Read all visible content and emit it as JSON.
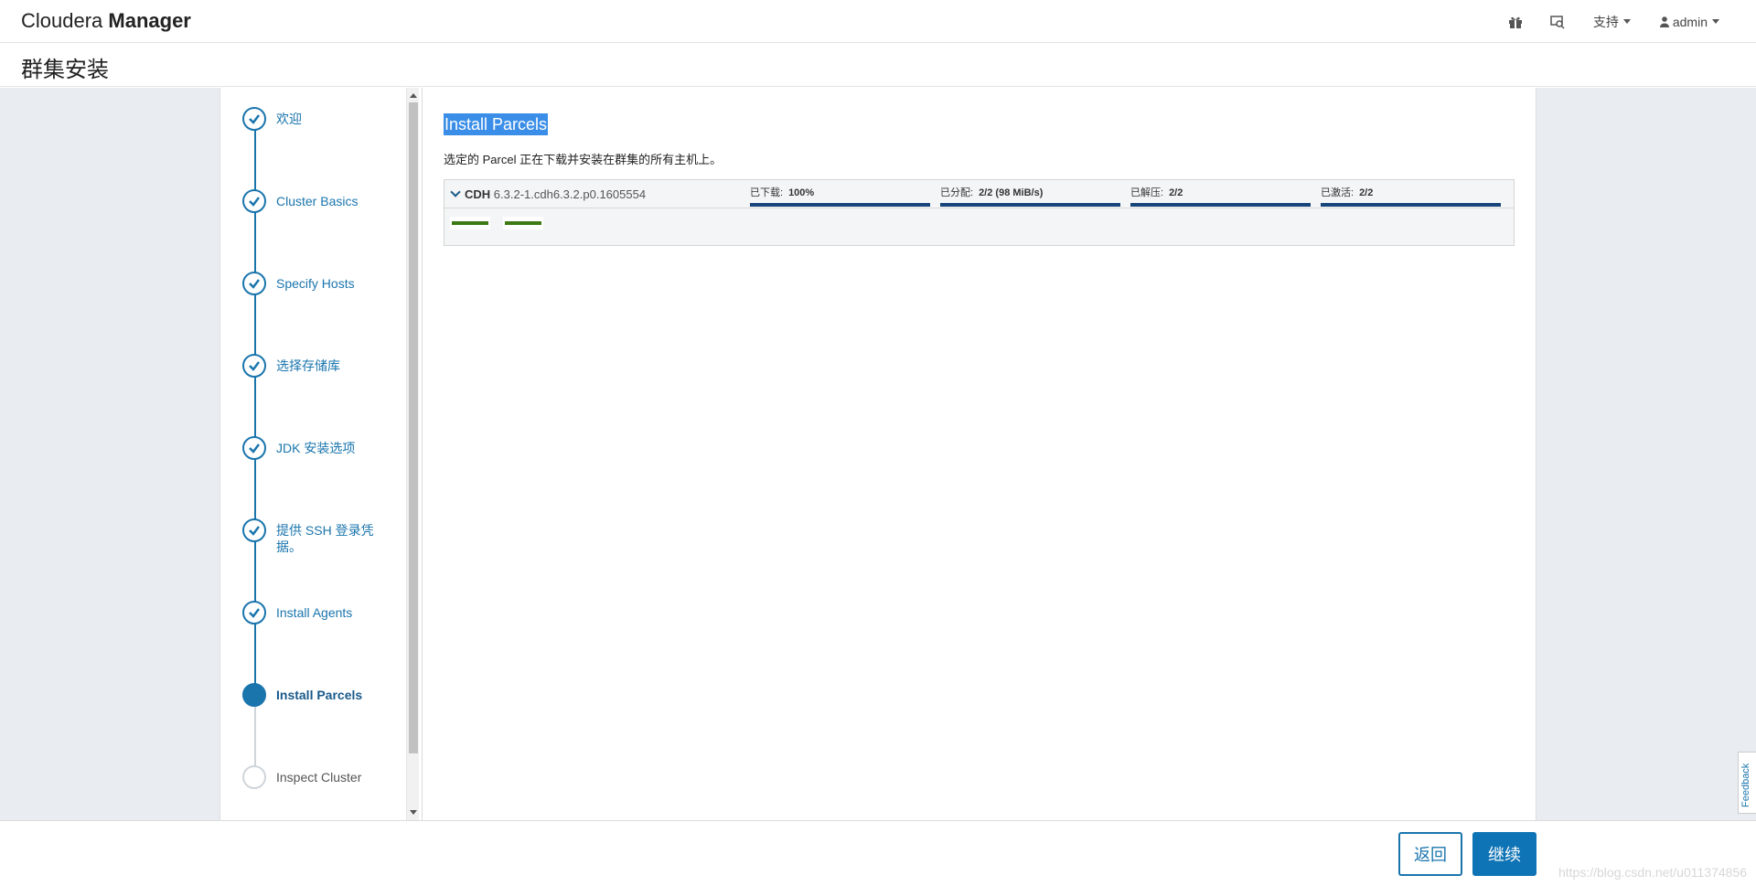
{
  "navbar": {
    "brand_light": "Cloudera ",
    "brand_bold": "Manager",
    "support_label": "支持",
    "user_label": "admin"
  },
  "page": {
    "title": "群集安装"
  },
  "steps": [
    {
      "label": "欢迎",
      "state": "done"
    },
    {
      "label": "Cluster Basics",
      "state": "done"
    },
    {
      "label": "Specify Hosts",
      "state": "done"
    },
    {
      "label": "选择存储库",
      "state": "done"
    },
    {
      "label": "JDK 安装选项",
      "state": "done"
    },
    {
      "label": "提供 SSH 登录凭据。",
      "state": "done"
    },
    {
      "label": "Install Agents",
      "state": "done"
    },
    {
      "label": "Install Parcels",
      "state": "active"
    },
    {
      "label": "Inspect Cluster",
      "state": "pending"
    }
  ],
  "content": {
    "title": "Install Parcels",
    "description": "选定的 Parcel 正在下载并安装在群集的所有主机上。",
    "parcel": {
      "product": "CDH",
      "version": "6.3.2-1.cdh6.3.2.p0.1605554",
      "stages": [
        {
          "label": "已下载:",
          "value": "100%",
          "progress": 1.0
        },
        {
          "label": "已分配:",
          "value": "2/2 (98 MiB/s)",
          "progress": 1.0
        },
        {
          "label": "已解压:",
          "value": "2/2",
          "progress": 1.0
        },
        {
          "label": "已激活:",
          "value": "2/2",
          "progress": 1.0
        }
      ]
    }
  },
  "footer": {
    "back_label": "返回",
    "continue_label": "继续",
    "watermark": "https://blog.csdn.net/u011374856"
  },
  "feedback_label": "Feedback"
}
